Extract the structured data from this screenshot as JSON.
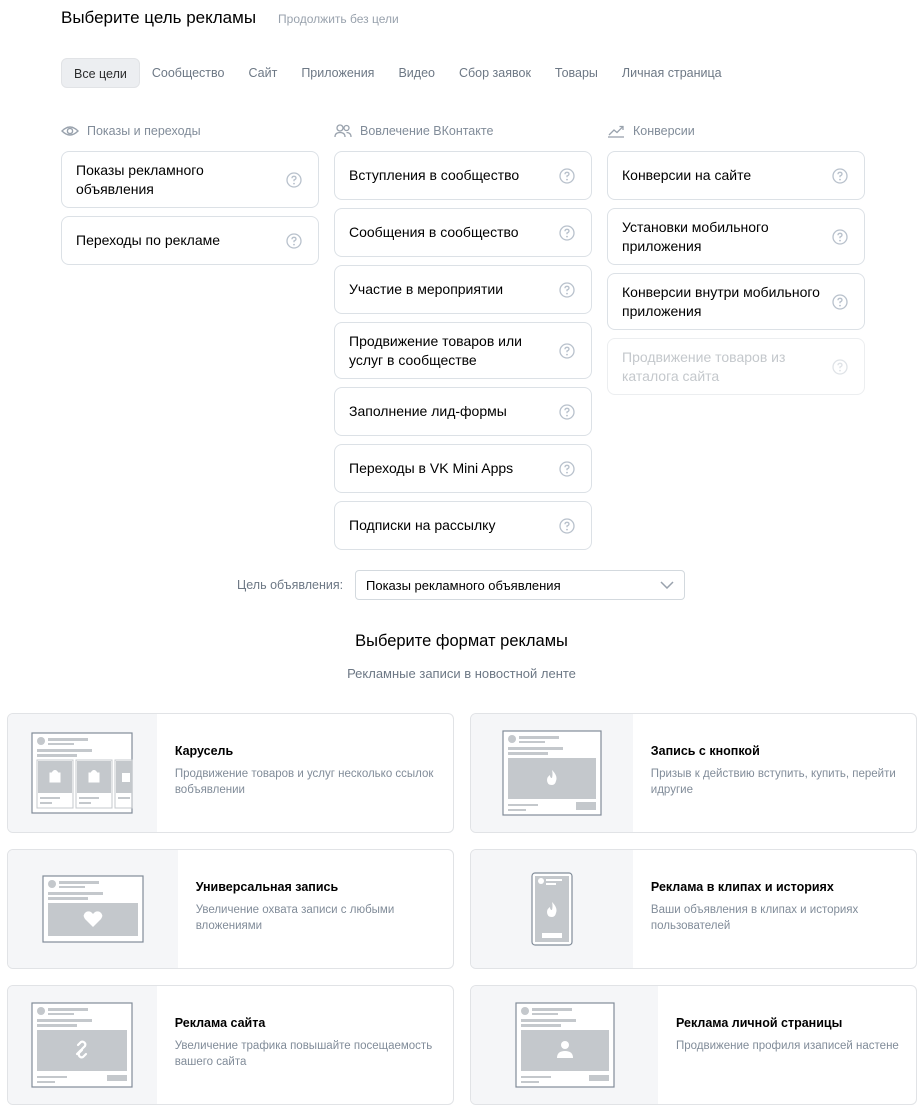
{
  "header": {
    "title": "Выберите цель рекламы",
    "skip_link": "Продолжить без цели"
  },
  "tabs": [
    "Все цели",
    "Сообщество",
    "Сайт",
    "Приложения",
    "Видео",
    "Сбор заявок",
    "Товары",
    "Личная страница"
  ],
  "active_tab": "Все цели",
  "columns": [
    {
      "heading": "Показы и переходы",
      "icon": "eye-icon",
      "options": [
        "Показы рекламного объявления",
        "Переходы по рекламе"
      ]
    },
    {
      "heading": "Вовлечение ВКонтакте",
      "icon": "users-icon",
      "options": [
        "Вступления в сообщество",
        "Сообщения в сообщество",
        "Участие в мероприятии",
        "Продвижение товаров или услуг в сообществе",
        "Заполнение лид-формы",
        "Переходы в VK Mini Apps",
        "Подписки на рассылку"
      ]
    },
    {
      "heading": "Конверсии",
      "icon": "trend-up-icon",
      "options": [
        "Конверсии на сайте",
        "Установки мобильного приложения",
        "Конверсии внутри мобильного приложения",
        "Продвижение товаров из каталога сайта"
      ],
      "disabled_option": "Продвижение товаров из каталога сайта"
    }
  ],
  "goal": {
    "label": "Цель объявления:",
    "value": "Показы рекламного объявления"
  },
  "format": {
    "title": "Выберите формат рекламы",
    "subtitle": "Рекламные записи в новостной ленте",
    "cards": [
      {
        "name": "Карусель",
        "desc": "Продвижение товаров и услуг несколько ссылок вобъявлении",
        "thumb": "carousel"
      },
      {
        "name": "Запись с кнопкой",
        "desc": "Призыв к действию   вступить, купить, перейти идругие",
        "thumb": "button-post"
      },
      {
        "name": "Универсальная запись",
        "desc": "Увеличение охвата   записи с любыми вложениями",
        "thumb": "universal"
      },
      {
        "name": "Реклама в клипах и историях",
        "desc": "Ваши объявления в клипах и историях пользователей",
        "thumb": "stories"
      },
      {
        "name": "Реклама сайта",
        "desc": "Увеличение трафика   повышайте посещаемость вашего сайта",
        "thumb": "site"
      },
      {
        "name": "Реклама личной страницы",
        "desc": "Продвижение профиля изаписей настене",
        "thumb": "profile"
      }
    ]
  },
  "colors": {
    "border": "#dce1e6",
    "muted": "#818c99",
    "thumb_bg": "#f5f6f8",
    "placeholder": "#c4c8cc"
  }
}
